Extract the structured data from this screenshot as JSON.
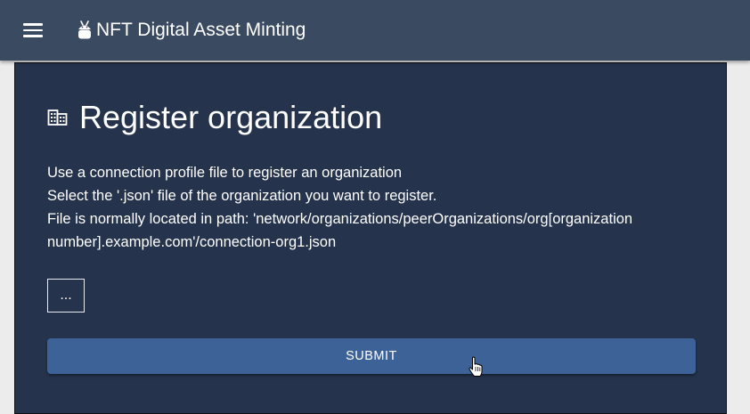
{
  "appbar": {
    "menu_icon": "menu-icon",
    "brand_icon": "android-icon",
    "title": "NFT Digital Asset Minting"
  },
  "card": {
    "title_icon": "business-icon",
    "title": "Register organization",
    "description": [
      "Use a connection profile file to register an organization",
      "Select the '.json' file of the organization you want to register.",
      "File is normally located in path: 'network/organizations/peerOrganizations/org[organization",
      "number].example.com'/connection-org1.json"
    ],
    "file_button_label": "...",
    "submit_label": "SUBMIT"
  },
  "colors": {
    "appbar": "#3a4a60",
    "card_bg": "#25334d",
    "submit": "#3c6298",
    "text": "#ffffff"
  }
}
